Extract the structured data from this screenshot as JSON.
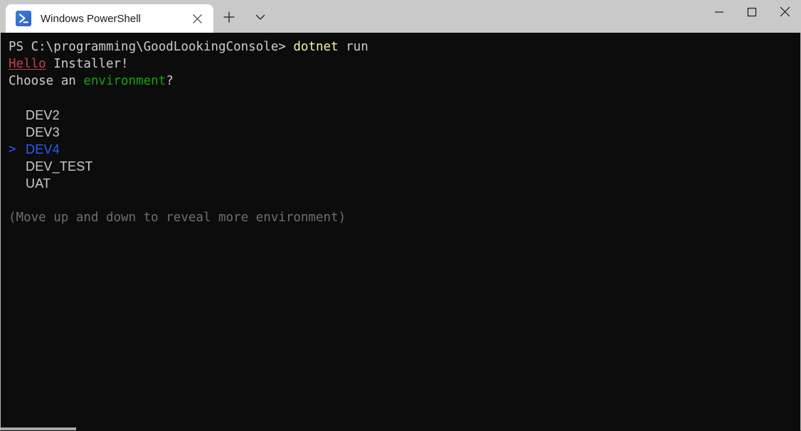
{
  "window": {
    "titlebar_color": "#c9c9c9",
    "terminal_background": "#0c0c0c",
    "controls": {
      "minimize": "minimize-icon",
      "maximize": "maximize-icon",
      "close": "close-icon"
    }
  },
  "tab": {
    "title": "Windows PowerShell",
    "icon": "powershell-icon",
    "close_icon": "close-icon",
    "new_tab_icon": "plus-icon",
    "dropdown_icon": "chevron-down-icon"
  },
  "terminal": {
    "prompt": {
      "path": "PS C:\\programming\\GoodLookingConsole> ",
      "command": "dotnet",
      "command_args": " run"
    },
    "greeting": {
      "word": "Hello",
      "rest": " Installer!"
    },
    "question": {
      "before": "Choose an ",
      "highlight": "environment",
      "after": "?"
    },
    "menu": {
      "marker": ">",
      "items": [
        {
          "label": "DEV2",
          "selected": false
        },
        {
          "label": "DEV3",
          "selected": false
        },
        {
          "label": "DEV4",
          "selected": true
        },
        {
          "label": "DEV_TEST",
          "selected": false
        },
        {
          "label": "UAT",
          "selected": false
        }
      ]
    },
    "hint": "(Move up and down to reveal more environment)",
    "colors": {
      "foreground": "#cccccc",
      "command": "#f3f3a8",
      "green": "#16a30f",
      "red": "#c2404b",
      "selection_blue": "#2f5bf5",
      "dim": "#6e6e6e"
    }
  }
}
